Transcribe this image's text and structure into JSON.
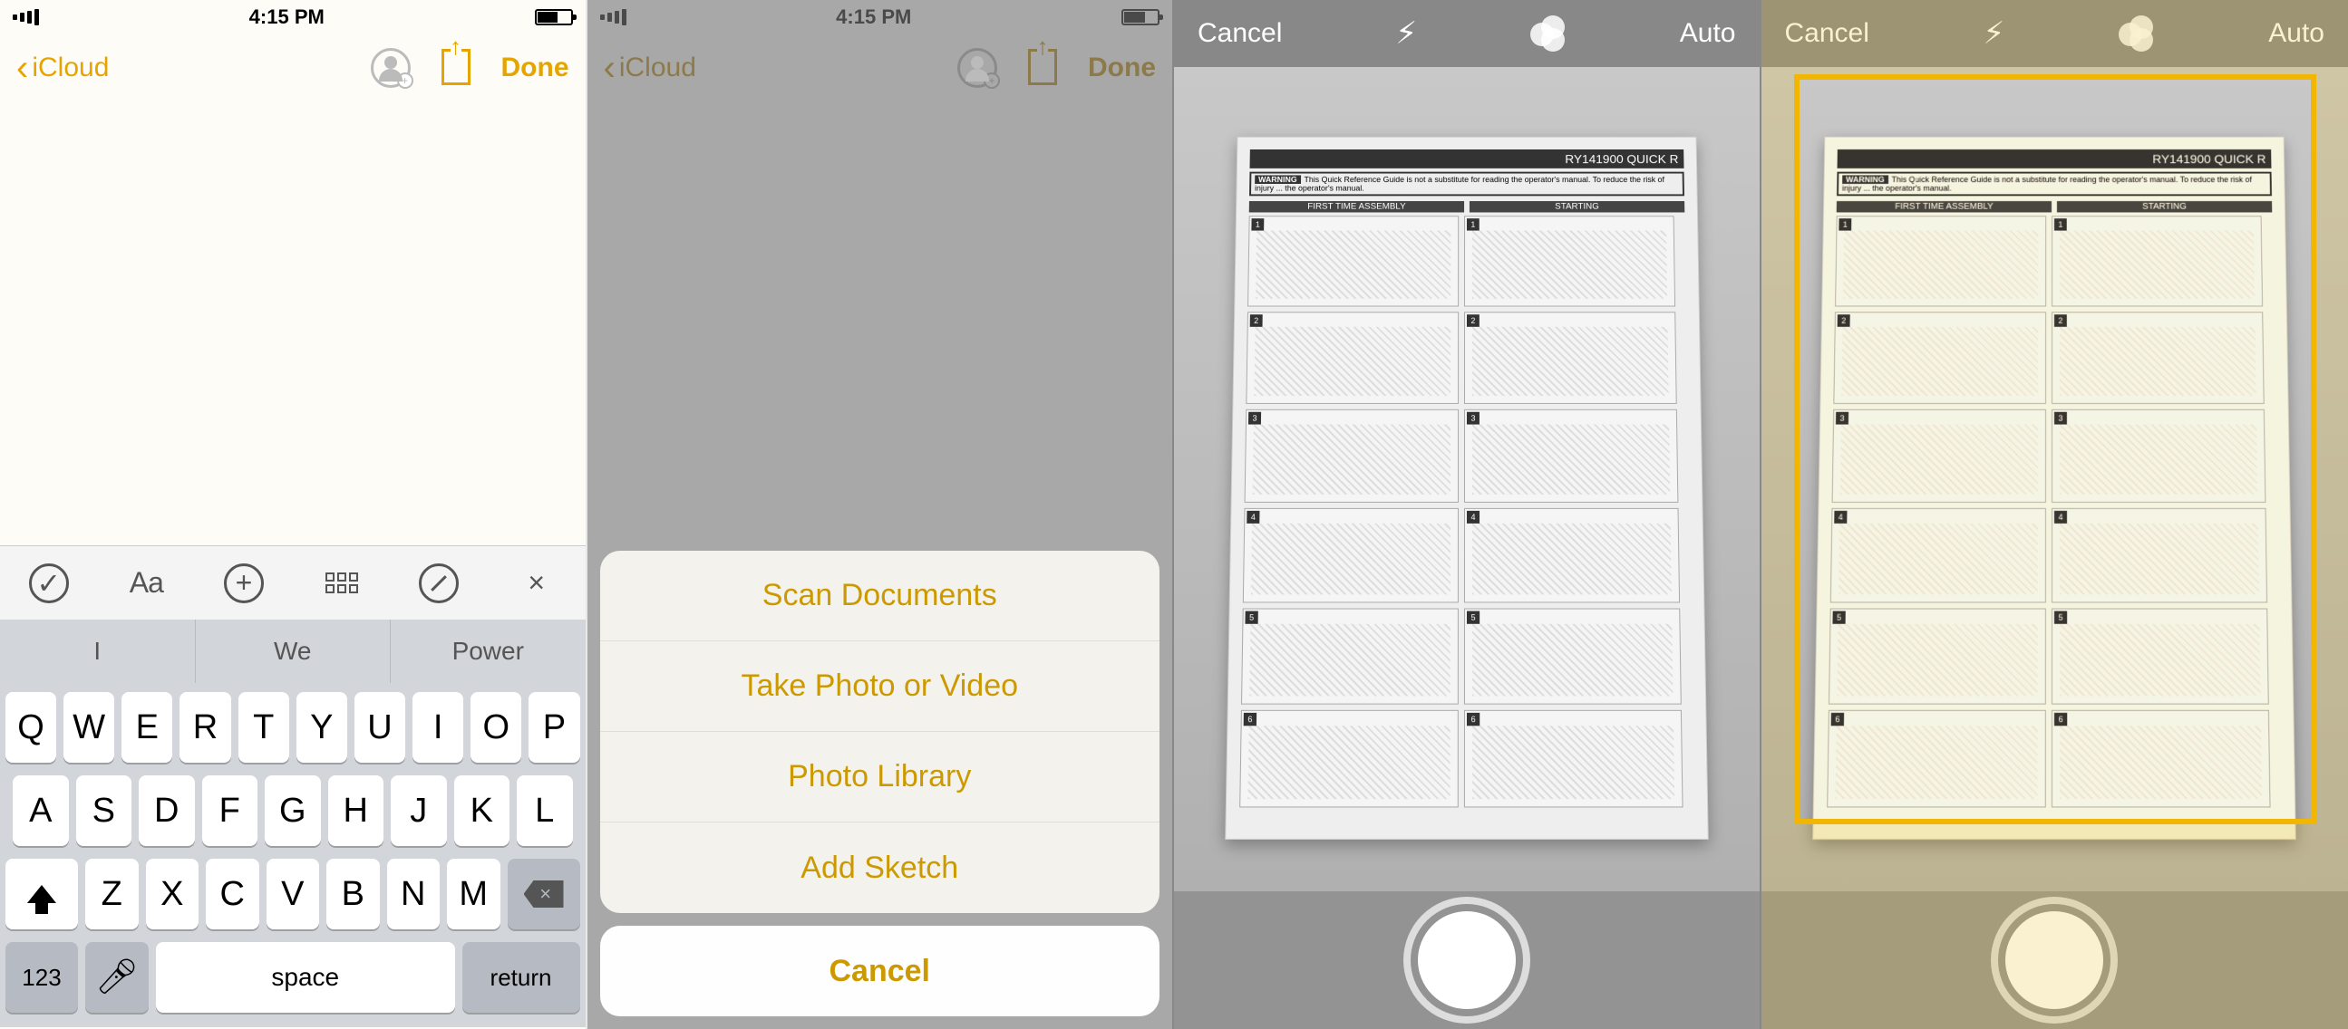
{
  "status": {
    "time": "4:15 PM"
  },
  "nav": {
    "back": "iCloud",
    "done": "Done"
  },
  "kbtoolbar": {
    "aa": "Aa"
  },
  "suggest": [
    "I",
    "We",
    "Power"
  ],
  "keys": {
    "row1": [
      "Q",
      "W",
      "E",
      "R",
      "T",
      "Y",
      "U",
      "I",
      "O",
      "P"
    ],
    "row2": [
      "A",
      "S",
      "D",
      "F",
      "G",
      "H",
      "J",
      "K",
      "L"
    ],
    "row3": [
      "Z",
      "X",
      "C",
      "V",
      "B",
      "N",
      "M"
    ],
    "num": "123",
    "space": "space",
    "return": "return"
  },
  "sheet": {
    "items": [
      "Scan Documents",
      "Take Photo or Video",
      "Photo Library",
      "Add Sketch"
    ],
    "cancel": "Cancel"
  },
  "cam": {
    "cancel": "Cancel",
    "auto": "Auto"
  },
  "doc": {
    "title": "RY141900 QUICK R",
    "warning_label": "WARNING",
    "warning_text": "This Quick Reference Guide is not a substitute for reading the operator's manual. To reduce the risk of injury ... the operator's manual.",
    "col1": "FIRST TIME ASSEMBLY",
    "col2": "STARTING"
  }
}
